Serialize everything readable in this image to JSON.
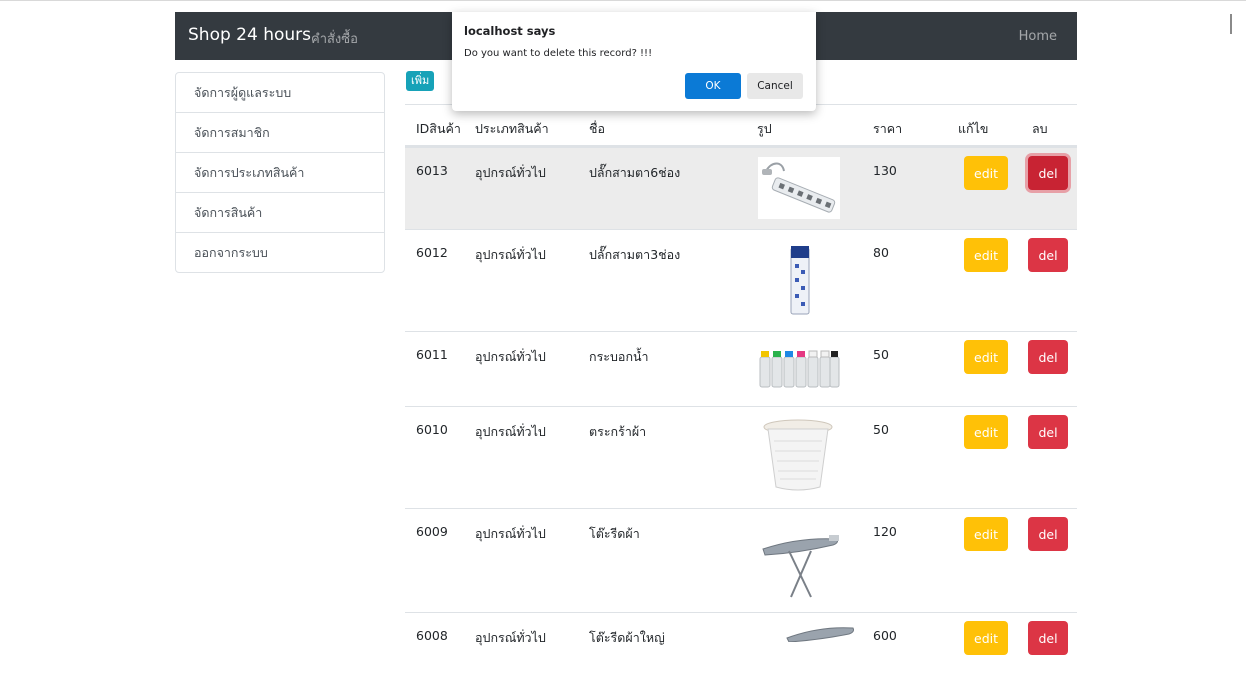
{
  "navbar": {
    "brand": "Shop 24 hours",
    "orders_link": "คำสั่งซื้อ",
    "home_link": "Home"
  },
  "sidebar": {
    "items": [
      {
        "label": "จัดการผู้ดูแลระบบ"
      },
      {
        "label": "จัดการสมาชิก"
      },
      {
        "label": "จัดการประเภทสินค้า"
      },
      {
        "label": "จัดการสินค้า"
      },
      {
        "label": "ออกจากระบบ"
      }
    ]
  },
  "toolbar": {
    "add_label": "เพิ่ม"
  },
  "table": {
    "headers": {
      "id": "IDสินค้า",
      "type": "ประเภทสินค้า",
      "name": "ชื่อ",
      "picture": "รูป",
      "price": "ราคา",
      "edit": "แก้ไข",
      "delete": "ลบ"
    },
    "edit_label": "edit",
    "delete_label": "del",
    "rows": [
      {
        "id": "6013",
        "type": "อุปกรณ์ทั่วไป",
        "name": "ปลั๊กสามตา6ช่อง",
        "price": "130",
        "image": "power-strip-6-image"
      },
      {
        "id": "6012",
        "type": "อุปกรณ์ทั่วไป",
        "name": "ปลั๊กสามตา3ช่อง",
        "price": "80",
        "image": "power-strip-3-image"
      },
      {
        "id": "6011",
        "type": "อุปกรณ์ทั่วไป",
        "name": "กระบอกน้ำ",
        "price": "50",
        "image": "water-bottles-image"
      },
      {
        "id": "6010",
        "type": "อุปกรณ์ทั่วไป",
        "name": "ตระกร้าผ้า",
        "price": "50",
        "image": "laundry-basket-image"
      },
      {
        "id": "6009",
        "type": "อุปกรณ์ทั่วไป",
        "name": "โต๊ะรีดผ้า",
        "price": "120",
        "image": "ironing-board-image"
      },
      {
        "id": "6008",
        "type": "อุปกรณ์ทั่วไป",
        "name": "โต๊ะรีดผ้าใหญ่",
        "price": "600",
        "image": "ironing-board-large-image"
      }
    ]
  },
  "dialog": {
    "title": "localhost says",
    "message": "Do you want to delete this record? !!!",
    "ok_label": "OK",
    "cancel_label": "Cancel"
  },
  "colors": {
    "navbar": "#343a40",
    "add": "#17a2b8",
    "edit": "#ffc107",
    "delete": "#dc3545",
    "dialog_ok": "#0b7ad6"
  }
}
